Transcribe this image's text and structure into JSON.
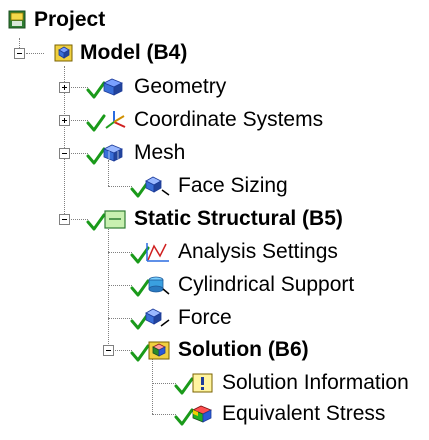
{
  "tree": {
    "project": {
      "label": "Project"
    },
    "model": {
      "label": "Model (B4)"
    },
    "geometry": {
      "label": "Geometry"
    },
    "coordinate_systems": {
      "label": "Coordinate Systems"
    },
    "mesh": {
      "label": "Mesh"
    },
    "face_sizing": {
      "label": "Face Sizing"
    },
    "static_structural": {
      "label": "Static Structural (B5)"
    },
    "analysis_settings": {
      "label": "Analysis Settings"
    },
    "cylindrical_support": {
      "label": "Cylindrical Support"
    },
    "force": {
      "label": "Force"
    },
    "solution": {
      "label": "Solution (B6)"
    },
    "solution_information": {
      "label": "Solution Information"
    },
    "equivalent_stress": {
      "label": "Equivalent Stress"
    }
  },
  "colors": {
    "check": "#1a9a1a",
    "part_blue": "#3a6fd8",
    "folder_yellow": "#f0c800",
    "connector": "#808080"
  }
}
